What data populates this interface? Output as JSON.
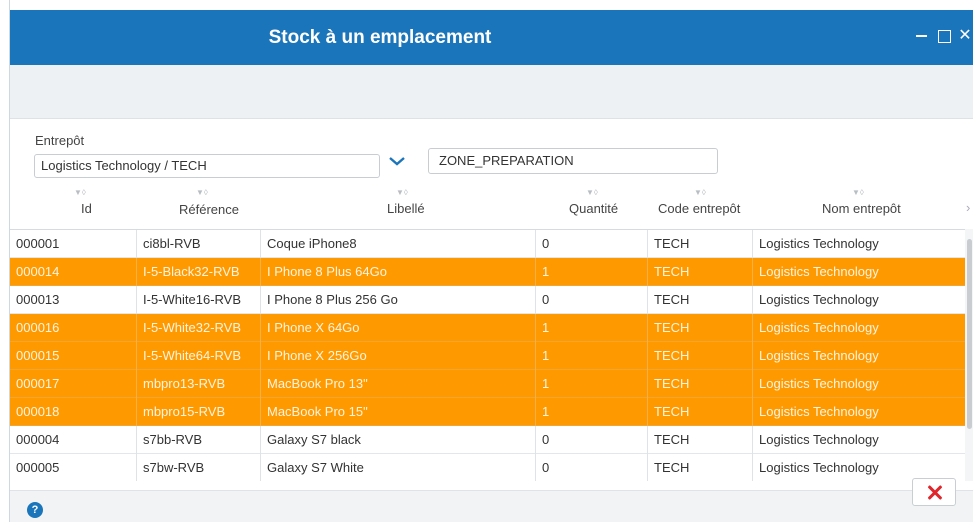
{
  "window": {
    "title": "Stock à un emplacement"
  },
  "filters": {
    "entrepot_label": "Entrepôt",
    "entrepot_value": "Logistics Technology / TECH",
    "zone_value": "ZONE_PREPARATION"
  },
  "columns": [
    "Id",
    "Référence",
    "Libellé",
    "Quantité",
    "Code entrepôt",
    "Nom entrepôt"
  ],
  "rows": [
    {
      "id": "000001",
      "ref": "ci8bl-RVB",
      "libelle": "Coque iPhone8",
      "qte": "0",
      "code": "TECH",
      "nom": "Logistics Technology",
      "selected": false
    },
    {
      "id": "000014",
      "ref": "I-5-Black32-RVB",
      "libelle": "I Phone 8 Plus 64Go",
      "qte": "1",
      "code": "TECH",
      "nom": "Logistics Technology",
      "selected": true
    },
    {
      "id": "000013",
      "ref": "I-5-White16-RVB",
      "libelle": "I Phone 8 Plus 256 Go",
      "qte": "0",
      "code": "TECH",
      "nom": "Logistics Technology",
      "selected": false
    },
    {
      "id": "000016",
      "ref": "I-5-White32-RVB",
      "libelle": "I Phone X 64Go",
      "qte": "1",
      "code": "TECH",
      "nom": "Logistics Technology",
      "selected": true
    },
    {
      "id": "000015",
      "ref": "I-5-White64-RVB",
      "libelle": "I Phone X 256Go",
      "qte": "1",
      "code": "TECH",
      "nom": "Logistics Technology",
      "selected": true
    },
    {
      "id": "000017",
      "ref": "mbpro13-RVB",
      "libelle": "MacBook Pro 13\"",
      "qte": "1",
      "code": "TECH",
      "nom": "Logistics Technology",
      "selected": true
    },
    {
      "id": "000018",
      "ref": "mbpro15-RVB",
      "libelle": "MacBook Pro 15\"",
      "qte": "1",
      "code": "TECH",
      "nom": "Logistics Technology",
      "selected": true
    },
    {
      "id": "000004",
      "ref": "s7bb-RVB",
      "libelle": "Galaxy S7 black",
      "qte": "0",
      "code": "TECH",
      "nom": "Logistics Technology",
      "selected": false
    },
    {
      "id": "000005",
      "ref": "s7bw-RVB",
      "libelle": "Galaxy S7 White",
      "qte": "0",
      "code": "TECH",
      "nom": "Logistics Technology",
      "selected": false
    }
  ],
  "footer": {
    "help_icon": "?"
  },
  "colors": {
    "titlebar": "#1b75bb",
    "selected_row": "#ff9900",
    "close_icon": "#e0252b"
  }
}
